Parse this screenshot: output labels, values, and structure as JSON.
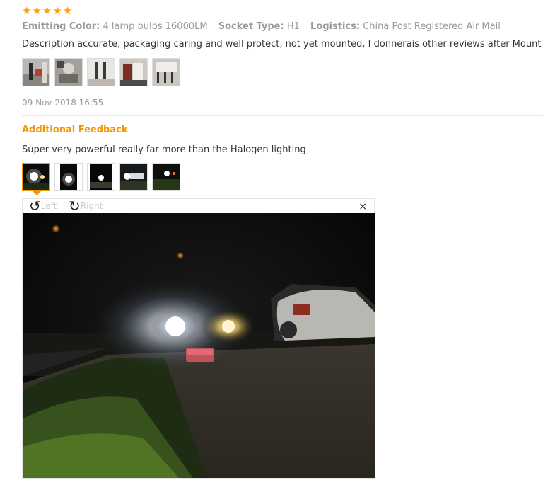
{
  "review": {
    "rating": 5,
    "props": [
      {
        "key": "Emitting Color:",
        "value": "4 lamp bulbs 16000LM"
      },
      {
        "key": "Socket Type:",
        "value": "H1"
      },
      {
        "key": "Logistics:",
        "value": "China Post Registered Air Mail"
      }
    ],
    "text": "Description accurate, packaging caring and well protect, not yet mounted, I donnerais other reviews after Mount",
    "date": "09 Nov 2018 16:55"
  },
  "additional": {
    "heading": "Additional Feedback",
    "text": "Super very powerful really far more than the Halogen lighting"
  },
  "viewer": {
    "rotate_left": "Left",
    "rotate_right": "Right",
    "close": "×"
  },
  "colors": {
    "accent": "#f39800",
    "star": "#f7a21b"
  }
}
